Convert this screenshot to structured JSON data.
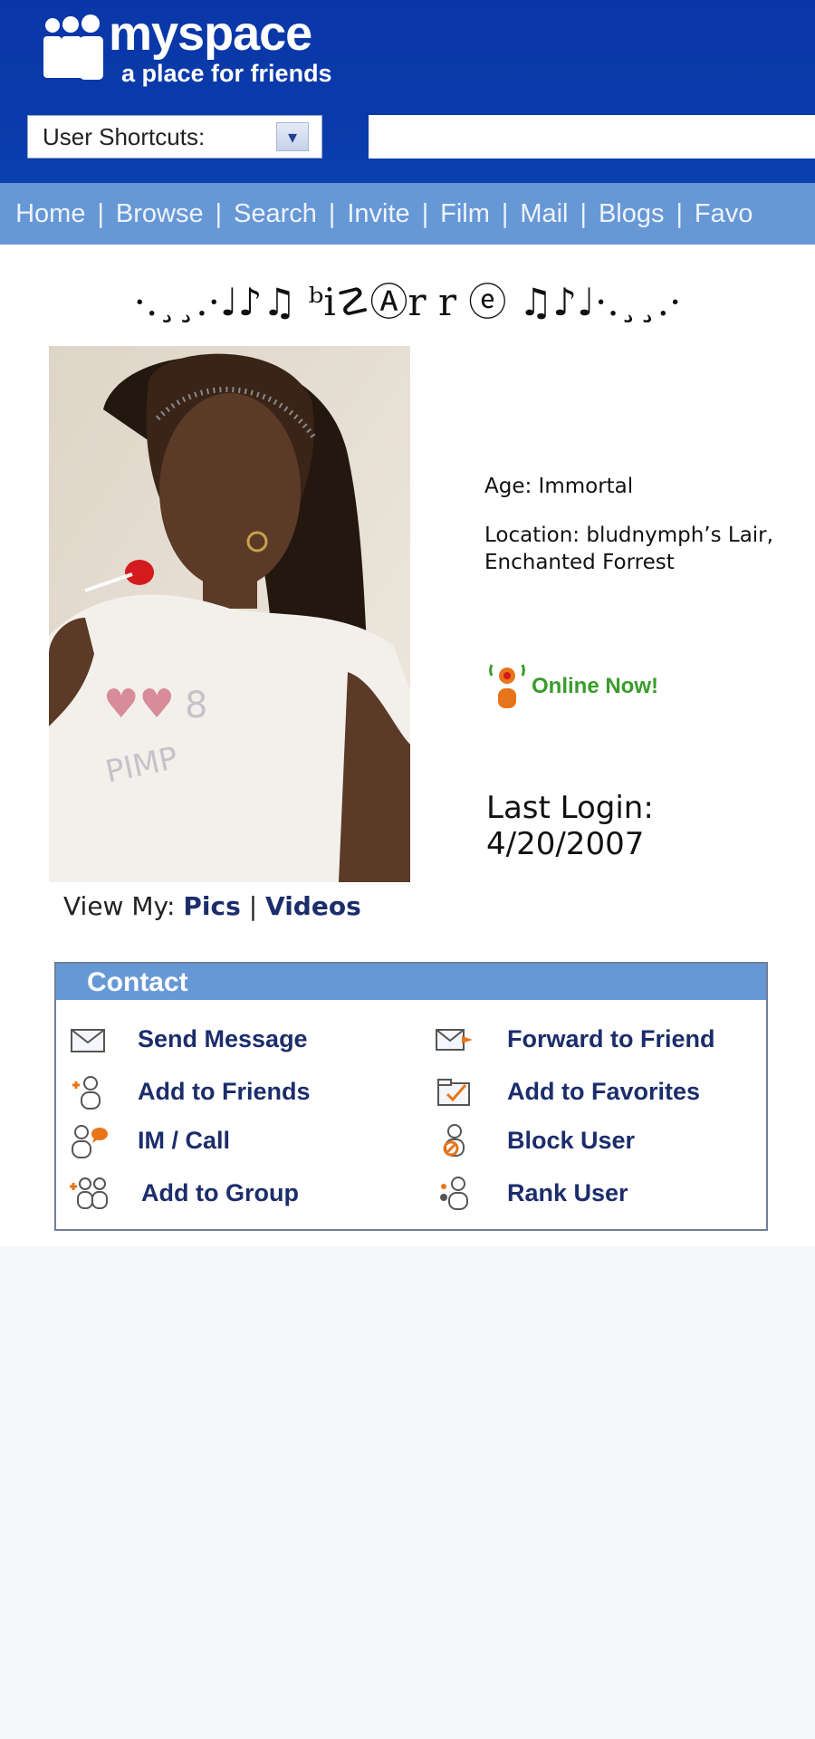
{
  "header": {
    "logo_name": "myspace",
    "logo_tagline": "a place for friends",
    "shortcuts_label": "User Shortcuts:",
    "search_value": ""
  },
  "nav": {
    "items": [
      "Home",
      "Browse",
      "Search",
      "Invite",
      "Film",
      "Mail",
      "Blogs",
      "Favo"
    ]
  },
  "profile": {
    "display_name": "·.¸¸.·♩♪♫ ᵇi☡Ⓐr r ⓔ ♫♪♩·.¸¸.·",
    "age": "Age: Immortal",
    "location": "Location: bludnymph’s Lair, Enchanted Forrest",
    "online_status": "Online Now!",
    "last_login_label": "Last Login:",
    "last_login_date": "4/20/2007",
    "view_my_label": "View My:",
    "view_pics": "Pics",
    "view_sep": "|",
    "view_videos": "Videos"
  },
  "contact": {
    "title": "Contact",
    "actions": [
      {
        "label": "Send Message",
        "icon": "envelope-icon"
      },
      {
        "label": "Forward to Friend",
        "icon": "forward-envelope-icon"
      },
      {
        "label": "Add to Friends",
        "icon": "add-person-icon"
      },
      {
        "label": "Add to Favorites",
        "icon": "favorite-folder-icon"
      },
      {
        "label": "IM / Call",
        "icon": "im-call-icon"
      },
      {
        "label": "Block User",
        "icon": "block-user-icon"
      },
      {
        "label": "Add to Group",
        "icon": "add-group-icon"
      },
      {
        "label": "Rank User",
        "icon": "rank-user-icon"
      }
    ]
  },
  "colors": {
    "header_blue": "#0a37a8",
    "nav_blue": "#6798d6",
    "link_navy": "#1c2d6b",
    "online_green": "#3a9c2c",
    "icon_orange": "#e8751a"
  }
}
